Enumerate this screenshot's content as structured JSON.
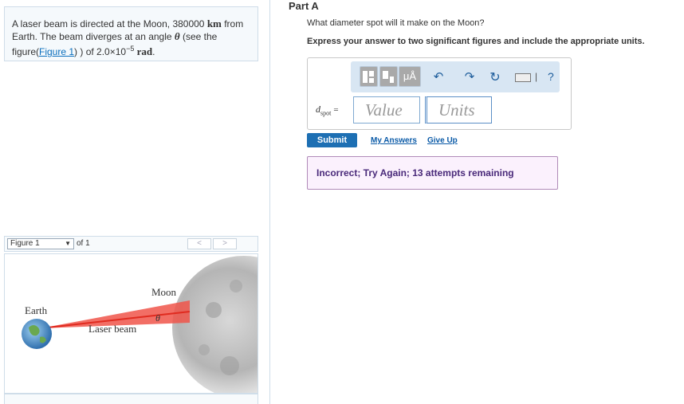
{
  "problem": {
    "text_a": "A laser beam is directed at the Moon, 380000 ",
    "unit_km": "km",
    "text_b": " from Earth. The beam diverges at an angle ",
    "theta": "θ",
    "text_c": " (see the figure(",
    "figure_link": "Figure 1",
    "text_d": ") ) of 2.0×10",
    "exponent": "−5",
    "unit_rad": " rad",
    "text_e": "."
  },
  "figure_nav": {
    "selected": "Figure 1",
    "of_label": "of 1",
    "prev": "<",
    "next": ">"
  },
  "figure": {
    "earth_label": "Earth",
    "moon_label": "Moon",
    "theta_label": "θ",
    "beam_label": "Laser beam"
  },
  "part": {
    "title": "Part A",
    "question": "What diameter spot will it make on the Moon?",
    "instruction": "Express your answer to two significant figures and include the appropriate units."
  },
  "answer": {
    "var": "d",
    "var_sub": "spot",
    "equals": "=",
    "value_placeholder": "Value",
    "units_placeholder": "Units"
  },
  "toolbar": {
    "micro_a": "μÅ",
    "help": "?"
  },
  "actions": {
    "submit": "Submit",
    "my_answers": "My Answers",
    "give_up": "Give Up"
  },
  "feedback": "Incorrect; Try Again; 13 attempts remaining"
}
